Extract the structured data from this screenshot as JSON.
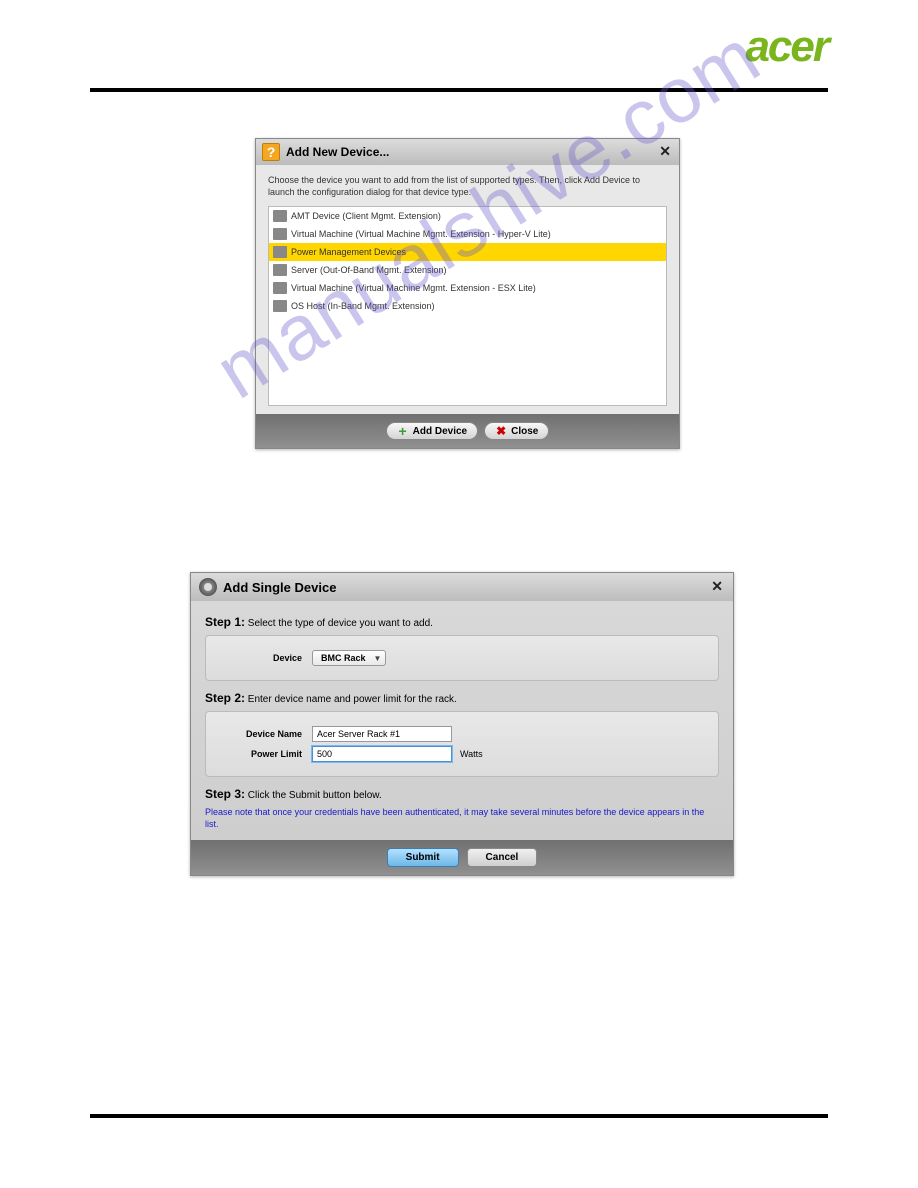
{
  "brand": "acer",
  "watermark": "manualshive.com",
  "dialog1": {
    "title": "Add New Device...",
    "instruction": "Choose the device you want to add from the list of supported types. Then, click Add Device to launch the configuration dialog for that device type.",
    "items": [
      "AMT Device (Client Mgmt. Extension)",
      "Virtual Machine (Virtual Machine Mgmt. Extension - Hyper-V Lite)",
      "Power Management Devices",
      "Server (Out-Of-Band Mgmt. Extension)",
      "Virtual Machine (Virtual Machine Mgmt. Extension - ESX Lite)",
      "OS Host (In-Band Mgmt. Extension)"
    ],
    "add_label": "Add Device",
    "close_label": "Close"
  },
  "dialog2": {
    "title": "Add Single Device",
    "step1_label": "Step 1:",
    "step1_text": "Select the type of device you want to add.",
    "device_label": "Device",
    "device_value": "BMC Rack",
    "step2_label": "Step 2:",
    "step2_text": "Enter device name and power limit for the rack.",
    "name_label": "Device Name",
    "name_value": "Acer Server Rack #1",
    "power_label": "Power Limit",
    "power_value": "500",
    "power_unit": "Watts",
    "step3_label": "Step 3:",
    "step3_text": "Click the Submit button below.",
    "note": "Please note that once your credentials have been authenticated, it may take several minutes before the device appears in the list.",
    "submit_label": "Submit",
    "cancel_label": "Cancel"
  }
}
